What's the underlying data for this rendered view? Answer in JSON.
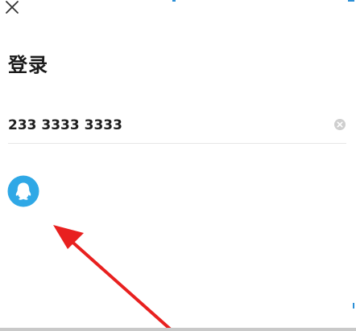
{
  "header": {
    "close_icon": "close-icon"
  },
  "login": {
    "title": "登录",
    "phone": {
      "value": "233 3333 3333"
    },
    "clear_icon": "clear-circle-icon",
    "third_party": {
      "qq_icon": "qq-penguin-icon"
    }
  },
  "annotation": {
    "arrow_color": "#e8201f"
  },
  "colors": {
    "qq_blue": "#2fa8e6",
    "text_dark": "#1a1a1a",
    "divider": "#e6e6e6"
  }
}
